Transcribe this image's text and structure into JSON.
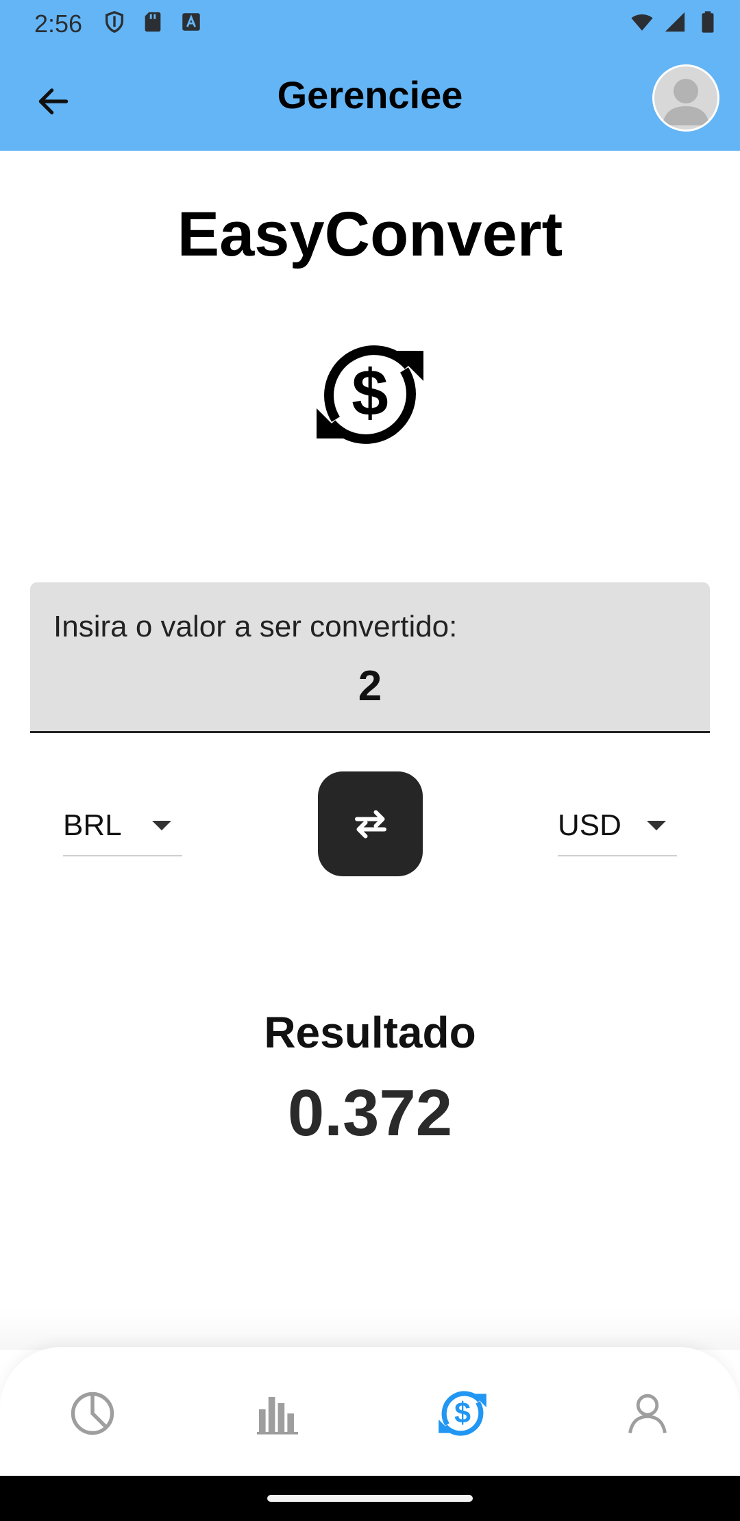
{
  "status_bar": {
    "time": "2:56"
  },
  "app_bar": {
    "title": "Gerenciee"
  },
  "page": {
    "title": "EasyConvert"
  },
  "input": {
    "label": "Insira o valor a ser convertido:",
    "value": "2"
  },
  "currency_from": {
    "value": "BRL"
  },
  "currency_to": {
    "value": "USD"
  },
  "result": {
    "label": "Resultado",
    "value": "0.372"
  },
  "bottom_nav": {
    "items": [
      {
        "icon": "pie-chart-icon"
      },
      {
        "icon": "bar-chart-icon"
      },
      {
        "icon": "currency-exchange-icon",
        "active": true
      },
      {
        "icon": "person-icon"
      }
    ]
  },
  "colors": {
    "app_bar": "#64b5f6",
    "active_nav": "#2196f3",
    "inactive_nav": "#9e9e9e",
    "swap_button": "#262626",
    "input_bg": "#e0e0e0"
  }
}
